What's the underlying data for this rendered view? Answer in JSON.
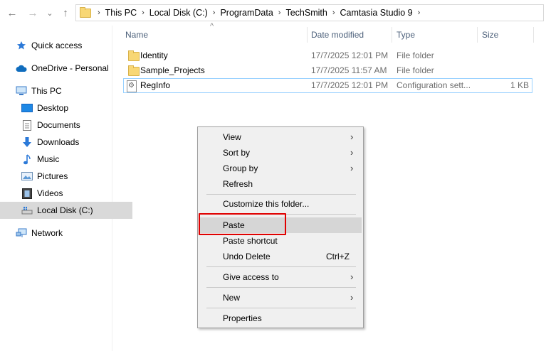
{
  "nav": {
    "back": "←",
    "forward": "→",
    "recent": "⌄",
    "up": "↑",
    "breadcrumbs": [
      "This PC",
      "Local Disk (C:)",
      "ProgramData",
      "TechSmith",
      "Camtasia Studio 9"
    ],
    "separator": "›"
  },
  "sidebar": {
    "items": [
      {
        "label": "Quick access",
        "icon": "star-icon"
      },
      {
        "label": "OneDrive - Personal",
        "icon": "cloud-icon"
      },
      {
        "label": "This PC",
        "icon": "computer-icon"
      },
      {
        "label": "Desktop",
        "icon": "desktop-icon"
      },
      {
        "label": "Documents",
        "icon": "document-icon"
      },
      {
        "label": "Downloads",
        "icon": "download-icon"
      },
      {
        "label": "Music",
        "icon": "music-icon"
      },
      {
        "label": "Pictures",
        "icon": "pictures-icon"
      },
      {
        "label": "Videos",
        "icon": "videos-icon"
      },
      {
        "label": "Local Disk (C:)",
        "icon": "drive-icon",
        "selected": true
      },
      {
        "label": "Network",
        "icon": "network-icon"
      }
    ]
  },
  "columns": {
    "sort_arrow": "^",
    "name": "Name",
    "date": "Date modified",
    "type": "Type",
    "size": "Size"
  },
  "files": [
    {
      "name": "Identity",
      "date": "17/7/2025 12:01 PM",
      "type": "File folder",
      "size": "",
      "icon": "folder-icon"
    },
    {
      "name": "Sample_Projects",
      "date": "17/7/2025 11:57 AM",
      "type": "File folder",
      "size": "",
      "icon": "folder-icon"
    },
    {
      "name": "RegInfo",
      "date": "17/7/2025 12:01 PM",
      "type": "Configuration sett...",
      "size": "1 KB",
      "icon": "config-file-icon"
    }
  ],
  "context_menu": {
    "items": [
      {
        "label": "View",
        "submenu": true
      },
      {
        "label": "Sort by",
        "submenu": true
      },
      {
        "label": "Group by",
        "submenu": true
      },
      {
        "label": "Refresh"
      },
      {
        "label": "Customize this folder..."
      },
      {
        "label": "Paste",
        "highlighted": true
      },
      {
        "label": "Paste shortcut"
      },
      {
        "label": "Undo Delete",
        "shortcut": "Ctrl+Z"
      },
      {
        "label": "Give access to",
        "submenu": true
      },
      {
        "label": "New",
        "submenu": true
      },
      {
        "label": "Properties"
      }
    ],
    "arrow": "›",
    "highlight_color": "#e00000"
  }
}
